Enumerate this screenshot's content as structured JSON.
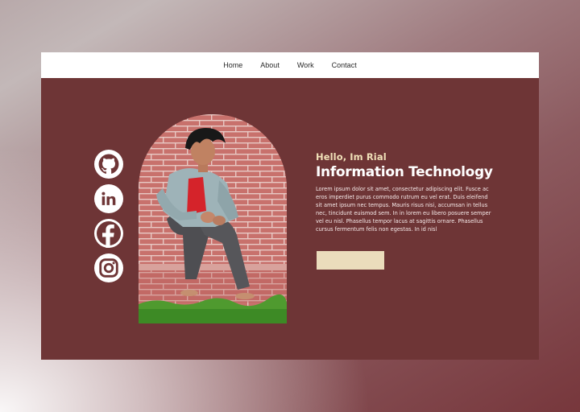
{
  "nav": {
    "items": [
      {
        "label": "Home"
      },
      {
        "label": "About"
      },
      {
        "label": "Work"
      },
      {
        "label": "Contact"
      }
    ]
  },
  "socials": [
    {
      "icon": "github-icon"
    },
    {
      "icon": "linkedin-icon"
    },
    {
      "icon": "facebook-icon"
    },
    {
      "icon": "instagram-icon"
    }
  ],
  "hero": {
    "greeting": "Hello, Im Rial",
    "title": "Information Technology",
    "bio": "Lorem ipsum dolor sit amet, consectetur adipiscing elit. Fusce ac eros imperdiet purus commodo rutrum eu vel erat. Duis eleifend sit amet ipsum nec tempus. Mauris risus nisi, accumsan in tellus nec, tincidunt euismod sem. In in lorem eu libero posuere semper vel eu nisl. Phasellus tempor lacus at sagittis ornare. Phasellus cursus fermentum felis non egestas. In id nisl",
    "button_label": ""
  },
  "colors": {
    "panel": "#6e3536",
    "accent": "#ebdcbc",
    "greeting": "#f0e0b8",
    "navbar": "#ffffff"
  }
}
